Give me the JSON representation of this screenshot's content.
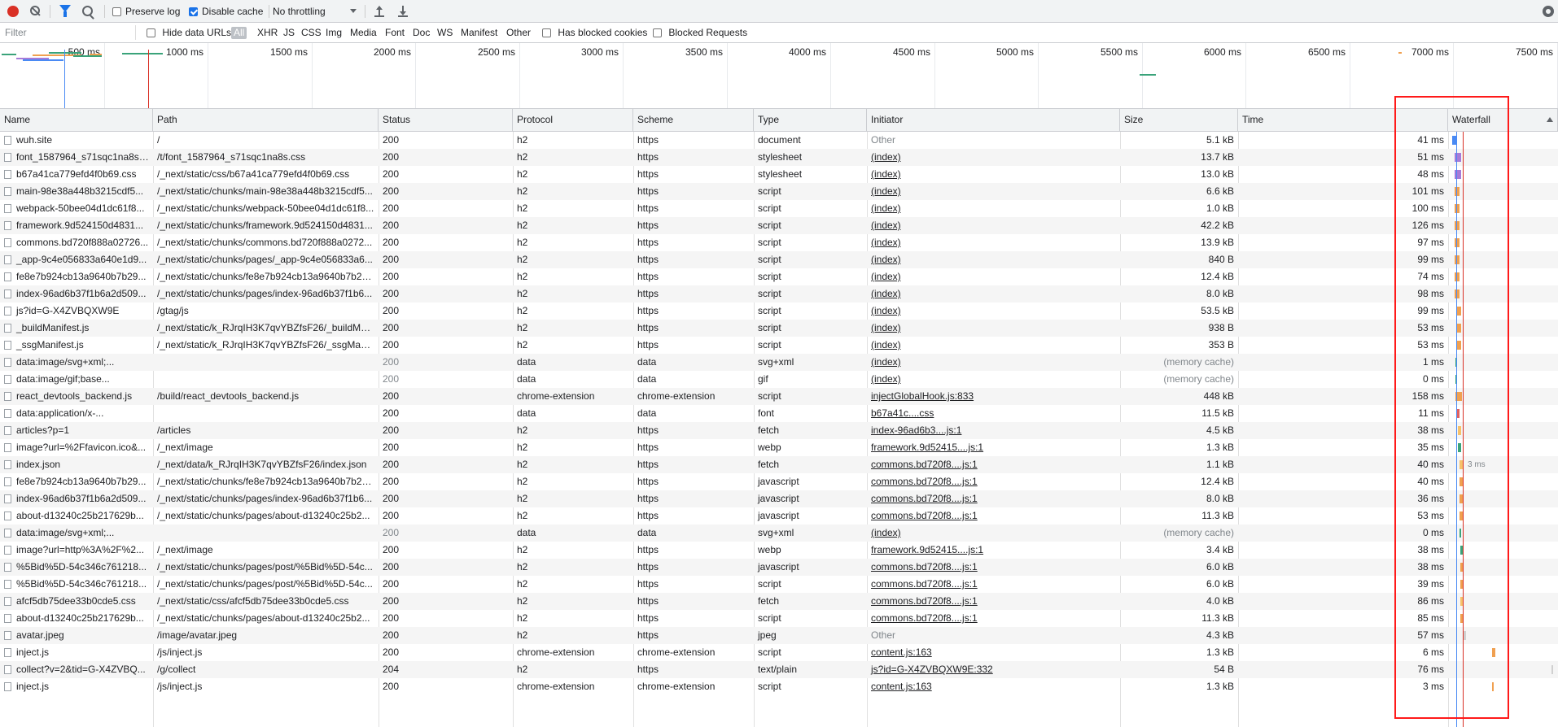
{
  "toolbar": {
    "preserve_log": {
      "label": "Preserve log",
      "checked": false
    },
    "disable_cache": {
      "label": "Disable cache",
      "checked": true
    },
    "throttling": "No throttling"
  },
  "filter_bar": {
    "placeholder": "Filter",
    "hide_data_urls": "Hide data URLs",
    "types": [
      "All",
      "XHR",
      "JS",
      "CSS",
      "Img",
      "Media",
      "Font",
      "Doc",
      "WS",
      "Manifest",
      "Other"
    ],
    "active_type": "All",
    "has_blocked_cookies": "Has blocked cookies",
    "blocked_requests": "Blocked Requests"
  },
  "overview": {
    "ticks": [
      "500 ms",
      "1000 ms",
      "1500 ms",
      "2000 ms",
      "2500 ms",
      "3000 ms",
      "3500 ms",
      "4000 ms",
      "4500 ms",
      "5000 ms",
      "5500 ms",
      "6000 ms",
      "6500 ms",
      "7000 ms",
      "7500 ms"
    ]
  },
  "columns": [
    "Name",
    "Path",
    "Status",
    "Protocol",
    "Scheme",
    "Type",
    "Initiator",
    "Size",
    "Time",
    "Waterfall"
  ],
  "requests": [
    {
      "name": "wuh.site",
      "path": "/",
      "status": "200",
      "protocol": "h2",
      "scheme": "https",
      "type": "document",
      "initiator": "Other",
      "initiator_link": false,
      "size": "5.1 kB",
      "time": "41 ms",
      "wf_color": "#4a8af4",
      "wf_start": 0.005,
      "wf_len": 0.03
    },
    {
      "name": "font_1587964_s71sqc1na8s.css",
      "path": "/t/font_1587964_s71sqc1na8s.css",
      "status": "200",
      "protocol": "h2",
      "scheme": "https",
      "type": "stylesheet",
      "initiator": "(index)",
      "initiator_link": true,
      "size": "13.7 kB",
      "time": "51 ms",
      "wf_color": "#a77bd8",
      "wf_start": 0.03,
      "wf_len": 0.04
    },
    {
      "name": "b67a41ca779efd4f0b69.css",
      "path": "/_next/static/css/b67a41ca779efd4f0b69.css",
      "status": "200",
      "protocol": "h2",
      "scheme": "https",
      "type": "stylesheet",
      "initiator": "(index)",
      "initiator_link": true,
      "size": "13.0 kB",
      "time": "48 ms",
      "wf_color": "#a77bd8",
      "wf_start": 0.03,
      "wf_len": 0.04
    },
    {
      "name": "main-98e38a448b3215cdf5...",
      "path": "/_next/static/chunks/main-98e38a448b3215cdf5...",
      "status": "200",
      "protocol": "h2",
      "scheme": "https",
      "type": "script",
      "initiator": "(index)",
      "initiator_link": true,
      "size": "6.6 kB",
      "time": "101 ms",
      "wf_color": "#f0a050",
      "wf_start": 0.03,
      "wf_len": 0.03
    },
    {
      "name": "webpack-50bee04d1dc61f8...",
      "path": "/_next/static/chunks/webpack-50bee04d1dc61f8...",
      "status": "200",
      "protocol": "h2",
      "scheme": "https",
      "type": "script",
      "initiator": "(index)",
      "initiator_link": true,
      "size": "1.0 kB",
      "time": "100 ms",
      "wf_color": "#f0a050",
      "wf_start": 0.03,
      "wf_len": 0.03
    },
    {
      "name": "framework.9d524150d4831...",
      "path": "/_next/static/chunks/framework.9d524150d4831...",
      "status": "200",
      "protocol": "h2",
      "scheme": "https",
      "type": "script",
      "initiator": "(index)",
      "initiator_link": true,
      "size": "42.2 kB",
      "time": "126 ms",
      "wf_color": "#f0a050",
      "wf_start": 0.03,
      "wf_len": 0.03
    },
    {
      "name": "commons.bd720f888a02726...",
      "path": "/_next/static/chunks/commons.bd720f888a0272...",
      "status": "200",
      "protocol": "h2",
      "scheme": "https",
      "type": "script",
      "initiator": "(index)",
      "initiator_link": true,
      "size": "13.9 kB",
      "time": "97 ms",
      "wf_color": "#f0a050",
      "wf_start": 0.03,
      "wf_len": 0.03
    },
    {
      "name": "_app-9c4e056833a640e1d9...",
      "path": "/_next/static/chunks/pages/_app-9c4e056833a6...",
      "status": "200",
      "protocol": "h2",
      "scheme": "https",
      "type": "script",
      "initiator": "(index)",
      "initiator_link": true,
      "size": "840 B",
      "time": "99 ms",
      "wf_color": "#f0a050",
      "wf_start": 0.03,
      "wf_len": 0.03
    },
    {
      "name": "fe8e7b924cb13a9640b7b29...",
      "path": "/_next/static/chunks/fe8e7b924cb13a9640b7b29...",
      "status": "200",
      "protocol": "h2",
      "scheme": "https",
      "type": "script",
      "initiator": "(index)",
      "initiator_link": true,
      "size": "12.4 kB",
      "time": "74 ms",
      "wf_color": "#f0a050",
      "wf_start": 0.03,
      "wf_len": 0.03
    },
    {
      "name": "index-96ad6b37f1b6a2d509...",
      "path": "/_next/static/chunks/pages/index-96ad6b37f1b6...",
      "status": "200",
      "protocol": "h2",
      "scheme": "https",
      "type": "script",
      "initiator": "(index)",
      "initiator_link": true,
      "size": "8.0 kB",
      "time": "98 ms",
      "wf_color": "#f0a050",
      "wf_start": 0.03,
      "wf_len": 0.03
    },
    {
      "name": "js?id=G-X4ZVBQXW9E",
      "path": "/gtag/js",
      "status": "200",
      "protocol": "h2",
      "scheme": "https",
      "type": "script",
      "initiator": "(index)",
      "initiator_link": true,
      "size": "53.5 kB",
      "time": "99 ms",
      "wf_color": "#f0a050",
      "wf_start": 0.05,
      "wf_len": 0.03
    },
    {
      "name": "_buildManifest.js",
      "path": "/_next/static/k_RJrqIH3K7qvYBZfsF26/_buildMani...",
      "status": "200",
      "protocol": "h2",
      "scheme": "https",
      "type": "script",
      "initiator": "(index)",
      "initiator_link": true,
      "size": "938 B",
      "time": "53 ms",
      "wf_color": "#f0a050",
      "wf_start": 0.05,
      "wf_len": 0.03
    },
    {
      "name": "_ssgManifest.js",
      "path": "/_next/static/k_RJrqIH3K7qvYBZfsF26/_ssgManif...",
      "status": "200",
      "protocol": "h2",
      "scheme": "https",
      "type": "script",
      "initiator": "(index)",
      "initiator_link": true,
      "size": "353 B",
      "time": "53 ms",
      "wf_color": "#f0a050",
      "wf_start": 0.05,
      "wf_len": 0.03
    },
    {
      "name": "data:image/svg+xml;...",
      "path": "",
      "status": "200",
      "status_dim": true,
      "protocol": "data",
      "scheme": "data",
      "type": "svg+xml",
      "initiator": "(index)",
      "initiator_link": true,
      "size": "(memory cache)",
      "size_dim": true,
      "time": "1 ms",
      "wf_color": "#3aa37a",
      "wf_start": 0.04,
      "wf_len": 0.01
    },
    {
      "name": "data:image/gif;base...",
      "path": "",
      "status": "200",
      "status_dim": true,
      "protocol": "data",
      "scheme": "data",
      "type": "gif",
      "initiator": "(index)",
      "initiator_link": true,
      "size": "(memory cache)",
      "size_dim": true,
      "time": "0 ms",
      "wf_color": "#3aa37a",
      "wf_start": 0.04,
      "wf_len": 0.01
    },
    {
      "name": "react_devtools_backend.js",
      "path": "/build/react_devtools_backend.js",
      "status": "200",
      "protocol": "chrome-extension",
      "scheme": "chrome-extension",
      "type": "script",
      "initiator": "injectGlobalHook.js:833",
      "initiator_link": true,
      "size": "448 kB",
      "time": "158 ms",
      "wf_color": "#f0a050",
      "wf_start": 0.04,
      "wf_len": 0.04
    },
    {
      "name": "data:application/x-...",
      "path": "",
      "status": "200",
      "protocol": "data",
      "scheme": "data",
      "type": "font",
      "initiator": "b67a41c....css",
      "initiator_link": true,
      "size": "11.5 kB",
      "time": "11 ms",
      "wf_color": "#e06060",
      "wf_start": 0.05,
      "wf_len": 0.02
    },
    {
      "name": "articles?p=1",
      "path": "/articles",
      "status": "200",
      "protocol": "h2",
      "scheme": "https",
      "type": "fetch",
      "initiator": "index-96ad6b3....js:1",
      "initiator_link": true,
      "size": "4.5 kB",
      "time": "38 ms",
      "wf_color": "#f6c26b",
      "wf_start": 0.06,
      "wf_len": 0.02
    },
    {
      "name": "image?url=%2Ffavicon.ico&...",
      "path": "/_next/image",
      "status": "200",
      "protocol": "h2",
      "scheme": "https",
      "type": "webp",
      "initiator": "framework.9d52415....js:1",
      "initiator_link": true,
      "size": "1.3 kB",
      "time": "35 ms",
      "wf_color": "#3aa37a",
      "wf_start": 0.06,
      "wf_len": 0.02
    },
    {
      "name": "index.json",
      "path": "/_next/data/k_RJrqIH3K7qvYBZfsF26/index.json",
      "status": "200",
      "protocol": "h2",
      "scheme": "https",
      "type": "fetch",
      "initiator": "commons.bd720f8....js:1",
      "initiator_link": true,
      "size": "1.1 kB",
      "time": "40 ms",
      "wf_color": "#f6c26b",
      "wf_start": 0.08,
      "wf_len": 0.02,
      "wf_note": "3 ms"
    },
    {
      "name": "fe8e7b924cb13a9640b7b29...",
      "path": "/_next/static/chunks/fe8e7b924cb13a9640b7b29...",
      "status": "200",
      "protocol": "h2",
      "scheme": "https",
      "type": "javascript",
      "initiator": "commons.bd720f8....js:1",
      "initiator_link": true,
      "size": "12.4 kB",
      "time": "40 ms",
      "wf_color": "#f0a050",
      "wf_start": 0.08,
      "wf_len": 0.02
    },
    {
      "name": "index-96ad6b37f1b6a2d509...",
      "path": "/_next/static/chunks/pages/index-96ad6b37f1b6...",
      "status": "200",
      "protocol": "h2",
      "scheme": "https",
      "type": "javascript",
      "initiator": "commons.bd720f8....js:1",
      "initiator_link": true,
      "size": "8.0 kB",
      "time": "36 ms",
      "wf_color": "#f0a050",
      "wf_start": 0.08,
      "wf_len": 0.02
    },
    {
      "name": "about-d13240c25b217629b...",
      "path": "/_next/static/chunks/pages/about-d13240c25b2...",
      "status": "200",
      "protocol": "h2",
      "scheme": "https",
      "type": "javascript",
      "initiator": "commons.bd720f8....js:1",
      "initiator_link": true,
      "size": "11.3 kB",
      "time": "53 ms",
      "wf_color": "#f0a050",
      "wf_start": 0.08,
      "wf_len": 0.02
    },
    {
      "name": "data:image/svg+xml;...",
      "path": "",
      "status": "200",
      "status_dim": true,
      "protocol": "data",
      "scheme": "data",
      "type": "svg+xml",
      "initiator": "(index)",
      "initiator_link": true,
      "size": "(memory cache)",
      "size_dim": true,
      "time": "0 ms",
      "wf_color": "#3aa37a",
      "wf_start": 0.08,
      "wf_len": 0.01
    },
    {
      "name": "image?url=http%3A%2F%2...",
      "path": "/_next/image",
      "status": "200",
      "protocol": "h2",
      "scheme": "https",
      "type": "webp",
      "initiator": "framework.9d52415....js:1",
      "initiator_link": true,
      "size": "3.4 kB",
      "time": "38 ms",
      "wf_color": "#3aa37a",
      "wf_start": 0.09,
      "wf_len": 0.02
    },
    {
      "name": "%5Bid%5D-54c346c761218...",
      "path": "/_next/static/chunks/pages/post/%5Bid%5D-54c...",
      "status": "200",
      "protocol": "h2",
      "scheme": "https",
      "type": "javascript",
      "initiator": "commons.bd720f8....js:1",
      "initiator_link": true,
      "size": "6.0 kB",
      "time": "38 ms",
      "wf_color": "#f0a050",
      "wf_start": 0.09,
      "wf_len": 0.02
    },
    {
      "name": "%5Bid%5D-54c346c761218...",
      "path": "/_next/static/chunks/pages/post/%5Bid%5D-54c...",
      "status": "200",
      "protocol": "h2",
      "scheme": "https",
      "type": "script",
      "initiator": "commons.bd720f8....js:1",
      "initiator_link": true,
      "size": "6.0 kB",
      "time": "39 ms",
      "wf_color": "#f0a050",
      "wf_start": 0.09,
      "wf_len": 0.02
    },
    {
      "name": "afcf5db75dee33b0cde5.css",
      "path": "/_next/static/css/afcf5db75dee33b0cde5.css",
      "status": "200",
      "protocol": "h2",
      "scheme": "https",
      "type": "fetch",
      "initiator": "commons.bd720f8....js:1",
      "initiator_link": true,
      "size": "4.0 kB",
      "time": "86 ms",
      "wf_color": "#f6c26b",
      "wf_start": 0.09,
      "wf_len": 0.02
    },
    {
      "name": "about-d13240c25b217629b...",
      "path": "/_next/static/chunks/pages/about-d13240c25b2...",
      "status": "200",
      "protocol": "h2",
      "scheme": "https",
      "type": "script",
      "initiator": "commons.bd720f8....js:1",
      "initiator_link": true,
      "size": "11.3 kB",
      "time": "85 ms",
      "wf_color": "#f0a050",
      "wf_start": 0.09,
      "wf_len": 0.02
    },
    {
      "name": "avatar.jpeg",
      "path": "/image/avatar.jpeg",
      "status": "200",
      "protocol": "h2",
      "scheme": "https",
      "type": "jpeg",
      "initiator": "Other",
      "initiator_link": false,
      "size": "4.3 kB",
      "time": "57 ms",
      "wf_color": "#d0d0d0",
      "wf_start": 0.11,
      "wf_len": 0.02
    },
    {
      "name": "inject.js",
      "path": "/js/inject.js",
      "status": "200",
      "protocol": "chrome-extension",
      "scheme": "chrome-extension",
      "type": "script",
      "initiator": "content.js:163",
      "initiator_link": true,
      "size": "1.3 kB",
      "time": "6 ms",
      "wf_color": "#f0a050",
      "wf_start": 0.4,
      "wf_len": 0.02
    },
    {
      "name": "collect?v=2&tid=G-X4ZVBQ...",
      "path": "/g/collect",
      "status": "204",
      "protocol": "h2",
      "scheme": "https",
      "type": "text/plain",
      "initiator": "js?id=G-X4ZVBQXW9E:332",
      "initiator_link": true,
      "size": "54 B",
      "time": "76 ms",
      "wf_color": "#d0d0d0",
      "wf_start": 0.98,
      "wf_len": 0.01
    },
    {
      "name": "inject.js",
      "path": "/js/inject.js",
      "status": "200",
      "protocol": "chrome-extension",
      "scheme": "chrome-extension",
      "type": "script",
      "initiator": "content.js:163",
      "initiator_link": true,
      "size": "1.3 kB",
      "time": "3 ms",
      "wf_color": "#f0a050",
      "wf_start": 0.4,
      "wf_len": 0.0
    }
  ]
}
